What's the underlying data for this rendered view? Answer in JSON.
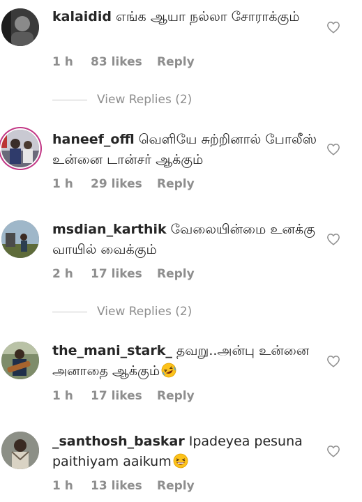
{
  "icons": {
    "heart": "heart-outline-icon"
  },
  "colors": {
    "text": "#262626",
    "secondary": "#8e8e8e",
    "story_ring": "#c13584"
  },
  "comments": [
    {
      "username": "kalaidid",
      "text": "எங்க ஆயா நல்லா சோராக்கும்",
      "time": "1 h",
      "likes": "83 likes",
      "reply": "Reply",
      "view_replies": "View Replies (2)"
    },
    {
      "username": "haneef_offl",
      "text": "வெளியே சுற்றினால் போலீஸ் உன்னை டான்சர் ஆக்கும்",
      "time": "1 h",
      "likes": "29 likes",
      "reply": "Reply"
    },
    {
      "username": "msdian_karthik",
      "text": "வேலையின்மை உனக்கு வாயில் வைக்கும்",
      "time": "2 h",
      "likes": "17 likes",
      "reply": "Reply",
      "view_replies": "View Replies (2)"
    },
    {
      "username": "the_mani_stark_",
      "text": "தவறு..அன்பு உன்னை அனாதை ஆக்கும்",
      "emoji": "rolling-laughing-emoji",
      "time": "1 h",
      "likes": "17 likes",
      "reply": "Reply"
    },
    {
      "username": "_santhosh_baskar",
      "text": "Ipadeyea pesuna paithiyam aaikum",
      "emoji": "laughing-emoji",
      "time": "1 h",
      "likes": "13 likes",
      "reply": "Reply"
    }
  ]
}
